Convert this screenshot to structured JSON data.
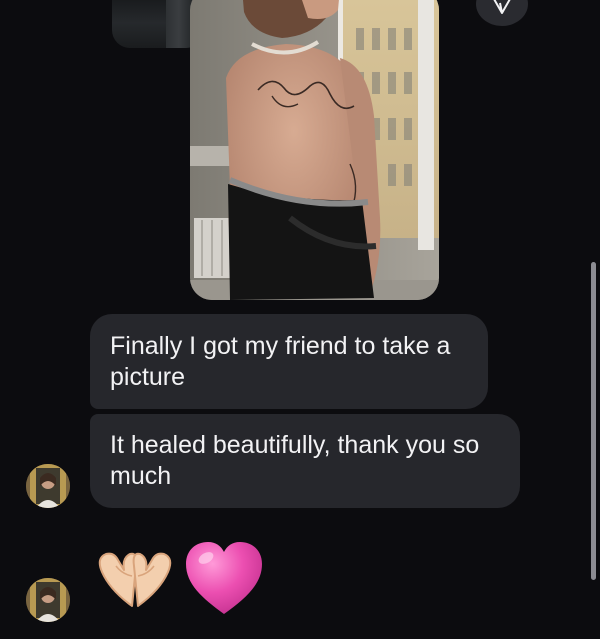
{
  "messages": [
    {
      "text": "Finally I got my friend to take a picture"
    },
    {
      "text": "It healed beautifully, thank you so much"
    }
  ],
  "reactions": [
    {
      "emoji": "🫶",
      "name": "heart-hands"
    },
    {
      "emoji": "🩷",
      "name": "pink-heart"
    }
  ],
  "colors": {
    "background": "#0c0c0f",
    "bubble": "#26272c",
    "text": "#f2f2f4",
    "heart": "#ec4fb1"
  },
  "icons": [
    "share-arrow-icon"
  ]
}
